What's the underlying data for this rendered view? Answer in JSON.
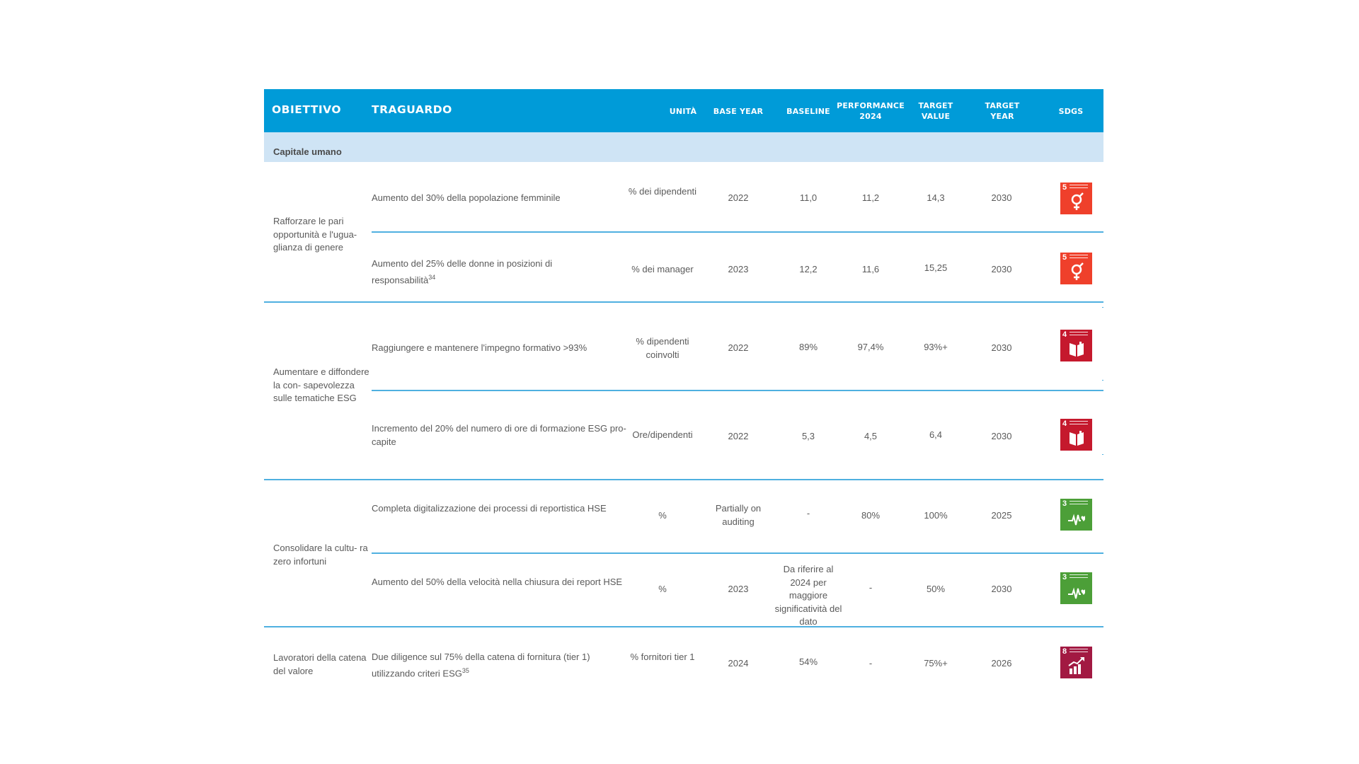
{
  "header": {
    "obiettivo": "OBIETTIVO",
    "traguardo": "TRAGUARDO",
    "unita": "UNITÀ",
    "base_year": "BASE YEAR",
    "baseline": "BASELINE",
    "performance": "PERFORMANCE 2024",
    "target_value": "TARGET VALUE",
    "target_year": "TARGET YEAR",
    "sdgs": "SDGS"
  },
  "section": {
    "title": "Capitale umano"
  },
  "objectives": [
    {
      "label": "Rafforzare le pari opportunità e l'ugua- glianza di genere"
    },
    {
      "label": "Aumentare e diffondere la con- sapevolezza sulle tematiche ESG"
    },
    {
      "label": "Consolidare la cultu- ra zero infortuni"
    },
    {
      "label": "Lavoratori della catena del valore"
    }
  ],
  "rows": [
    {
      "traguardo": "Aumento del 30% della popolazione femminile",
      "sup": "",
      "unita": "% dei dipendenti",
      "base_year": "2022",
      "baseline": "11,0",
      "performance": "11,2",
      "target_value": "14,3",
      "target_year": "2030",
      "sdg": {
        "number": "5",
        "name": "gender-equality-icon",
        "color": "#ef402b"
      }
    },
    {
      "traguardo": "Aumento del 25% delle donne in posizioni di responsabilità",
      "sup": "34",
      "unita": "% dei manager",
      "base_year": "2023",
      "baseline": "12,2",
      "performance": "11,6",
      "target_value": "15,25",
      "target_year": "2030",
      "sdg": {
        "number": "5",
        "name": "gender-equality-icon",
        "color": "#ef402b"
      }
    },
    {
      "traguardo": "Raggiungere e mantenere l'impegno formativo >93%",
      "sup": "",
      "unita": "% dipendenti coinvolti",
      "base_year": "2022",
      "baseline": "89%",
      "performance": "97,4%",
      "target_value": "93%+",
      "target_year": "2030",
      "sdg": {
        "number": "4",
        "name": "quality-education-icon",
        "color": "#c5192d"
      }
    },
    {
      "traguardo": "Incremento del 20% del numero di ore di formazione ESG pro-capite",
      "sup": "",
      "unita": "Ore/dipendenti",
      "base_year": "2022",
      "baseline": "5,3",
      "performance": "4,5",
      "target_value": "6,4",
      "target_year": "2030",
      "sdg": {
        "number": "4",
        "name": "quality-education-icon",
        "color": "#c5192d"
      }
    },
    {
      "traguardo": "Completa digitalizzazione dei processi di reportistica HSE",
      "sup": "",
      "unita": "%",
      "base_year": "Partially on auditing",
      "baseline": "-",
      "performance": "80%",
      "target_value": "100%",
      "target_year": "2025",
      "sdg": {
        "number": "3",
        "name": "good-health-icon",
        "color": "#4c9f38"
      }
    },
    {
      "traguardo": "Aumento del 50% della velocità nella chiusura dei report HSE",
      "sup": "",
      "unita": "%",
      "base_year": "2023",
      "baseline": "Da riferire al 2024 per maggiore significatività del dato",
      "performance": "-",
      "target_value": "50%",
      "target_year": "2030",
      "sdg": {
        "number": "3",
        "name": "good-health-icon",
        "color": "#4c9f38"
      }
    },
    {
      "traguardo": "Due diligence sul 75% della catena di fornitura (tier 1) utilizzando criteri ESG",
      "sup": "35",
      "unita": "% fornitori tier 1",
      "base_year": "2024",
      "baseline": "54%",
      "performance": "-",
      "target_value": "75%+",
      "target_year": "2026",
      "sdg": {
        "number": "8",
        "name": "decent-work-icon",
        "color": "#a21942"
      }
    }
  ]
}
